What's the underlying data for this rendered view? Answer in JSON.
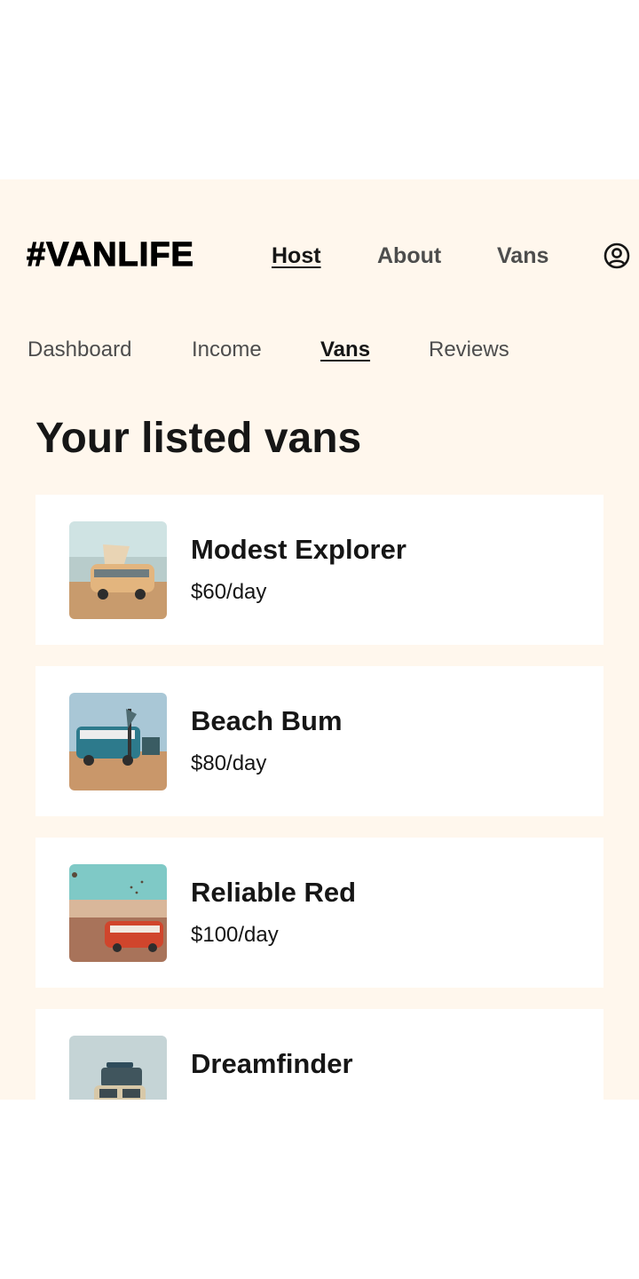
{
  "header": {
    "logo": "#VANLIFE",
    "nav": [
      {
        "label": "Host",
        "active": true
      },
      {
        "label": "About",
        "active": false
      },
      {
        "label": "Vans",
        "active": false
      }
    ],
    "avatar_icon": "user-circle-icon"
  },
  "host_nav": [
    {
      "label": "Dashboard",
      "active": false
    },
    {
      "label": "Income",
      "active": false
    },
    {
      "label": "Vans",
      "active": true
    },
    {
      "label": "Reviews",
      "active": false
    }
  ],
  "page_title": "Your listed vans",
  "vans": [
    {
      "name": "Modest Explorer",
      "price": "$60/day",
      "image_icon": "van-photo-icon"
    },
    {
      "name": "Beach Bum",
      "price": "$80/day",
      "image_icon": "van-photo-icon"
    },
    {
      "name": "Reliable Red",
      "price": "$100/day",
      "image_icon": "van-photo-icon"
    },
    {
      "name": "Dreamfinder",
      "price": "",
      "image_icon": "van-photo-icon"
    }
  ],
  "colors": {
    "background": "#FFF7ED",
    "card": "#FFFFFF",
    "text": "#161616",
    "nav_text": "#4D4D4D"
  }
}
